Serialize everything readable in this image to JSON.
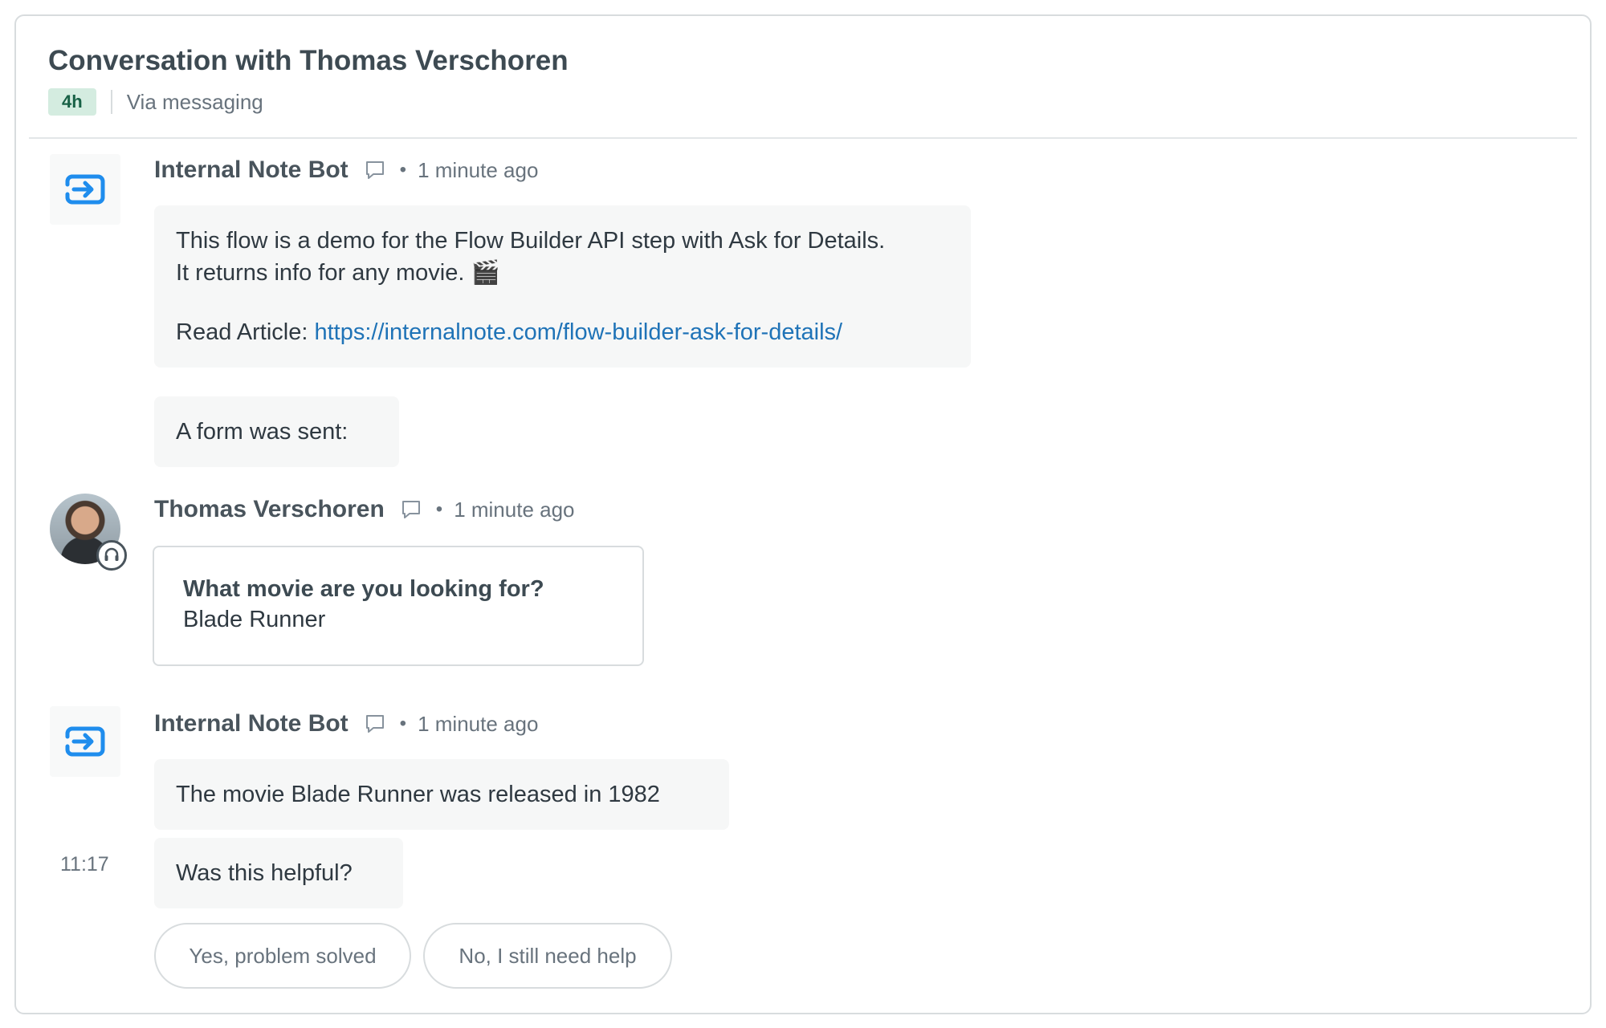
{
  "header": {
    "title": "Conversation with Thomas Verschoren",
    "badge": "4h",
    "channel": "Via messaging"
  },
  "messages": [
    {
      "author": "Internal Note Bot",
      "time_ago": "1 minute ago",
      "line1": "This flow is a demo for the Flow Builder API step with Ask for Details.",
      "line2": "It returns info for any movie. 🎬",
      "article_label": "Read Article: ",
      "article_url": "https://internalnote.com/flow-builder-ask-for-details/",
      "form_sent": "A form was sent:"
    },
    {
      "author": "Thomas Verschoren",
      "time_ago": "1 minute ago",
      "form_question": "What movie are you looking for?",
      "form_answer": "Blade Runner"
    },
    {
      "author": "Internal Note Bot",
      "time_ago": "1 minute ago",
      "answer": "The movie Blade Runner was released in 1982",
      "question": "Was this helpful?",
      "timestamp": "11:17",
      "replies": [
        "Yes, problem solved",
        "No, I still need help"
      ]
    }
  ],
  "icons": {
    "bot_icon": "transfer-arrow-icon",
    "chat_icon": "speech-bubble-icon",
    "agent_badge": "headset-icon"
  },
  "colors": {
    "link": "#1f73b7",
    "bot_icon": "#1f8ded",
    "badge_bg": "#d4ece0",
    "badge_text": "#186146"
  }
}
